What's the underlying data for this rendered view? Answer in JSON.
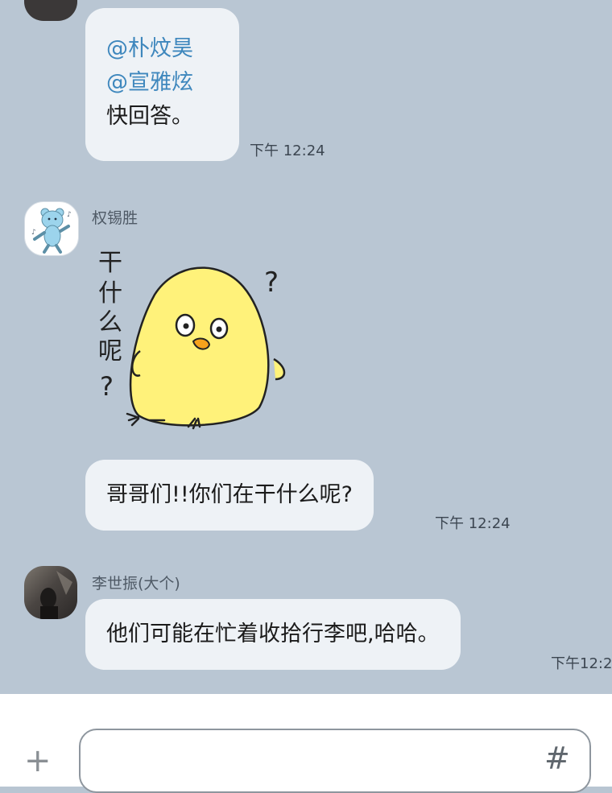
{
  "messages": [
    {
      "lines": [
        "@朴炆昊",
        "@宣雅炫",
        "快回答。"
      ],
      "time": "下午 12:24"
    },
    {
      "sender": "权锡胜",
      "sticker": {
        "side_text": [
          "干",
          "什",
          "么",
          "呢",
          "?"
        ],
        "question_mark": "?"
      }
    },
    {
      "text": "哥哥们!!你们在干什么呢?",
      "time": "下午 12:24"
    },
    {
      "sender": "李世振(大个)",
      "text": "他们可能在忙着收拾行李吧,哈哈。",
      "time": "下午12:2"
    }
  ],
  "composer": {
    "plus": "+",
    "hash": "#"
  },
  "colors": {
    "chat_bg": "#b9c6d3",
    "bubble": "#eef2f6",
    "mention": "#3e87bd",
    "chick": "#fff27a"
  }
}
